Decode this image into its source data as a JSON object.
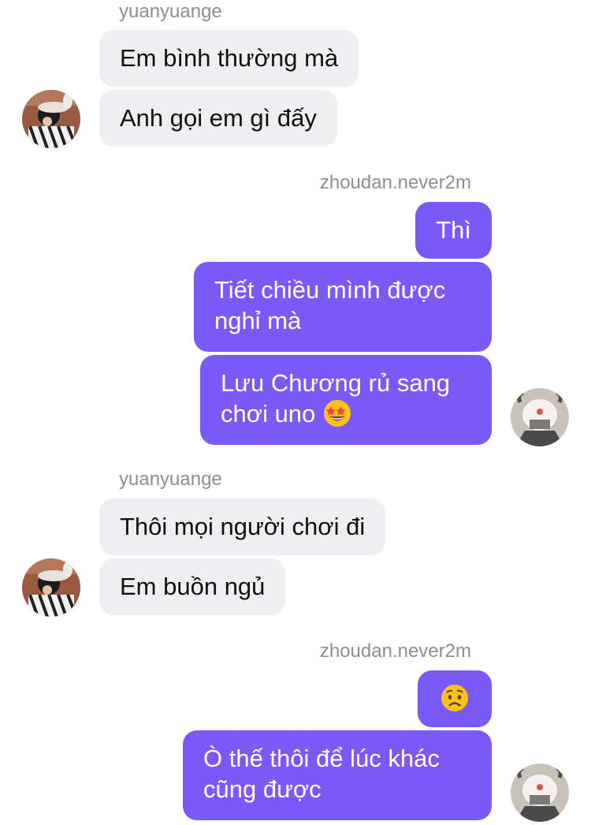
{
  "conversation": {
    "sender_left": "yuanyuange",
    "sender_right": "zhoudan.never2m",
    "messages": [
      {
        "from": "yuanyuange",
        "text": "Em bình thường mà"
      },
      {
        "from": "yuanyuange",
        "text": "Anh gọi em gì đấy"
      },
      {
        "from": "zhoudan.never2m",
        "text": "Thì"
      },
      {
        "from": "zhoudan.never2m",
        "text": "Tiết chiều mình được nghỉ mà"
      },
      {
        "from": "zhoudan.never2m",
        "text": "Lưu Chương rủ sang chơi uno",
        "emoji": "star-struck-emoji"
      },
      {
        "from": "yuanyuange",
        "text": "Thôi mọi người chơi đi"
      },
      {
        "from": "yuanyuange",
        "text": "Em buồn ngủ"
      },
      {
        "from": "zhoudan.never2m",
        "text": "",
        "emoji": "worried-face-emoji"
      },
      {
        "from": "zhoudan.never2m",
        "text": "Ò thế thôi để lúc khác cũng được"
      }
    ]
  },
  "colors": {
    "outgoing_bubble": "#7b59f7",
    "incoming_bubble": "#efeff2",
    "sender_name": "#8e8e93"
  }
}
